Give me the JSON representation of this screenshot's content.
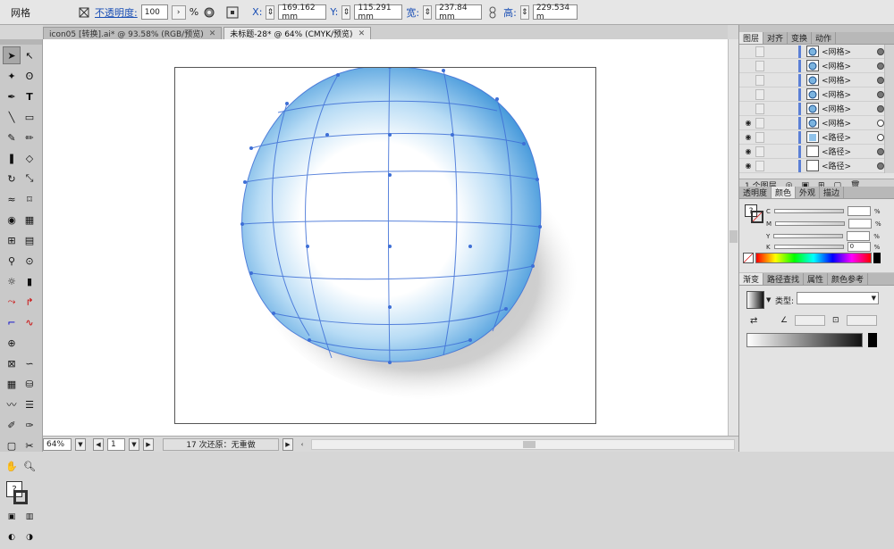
{
  "control_bar": {
    "selection_label": "网格",
    "opacity_label": "不透明度:",
    "opacity_value": "100",
    "percent": "%",
    "x_label": "X:",
    "x_value": "169.162 mm",
    "y_label": "Y:",
    "y_value": "115.291 mm",
    "width_label": "宽:",
    "width_value": "237.84 mm",
    "height_label": "高:",
    "height_value": "229.534 m"
  },
  "tabs": [
    {
      "label": "icon05 [转换].ai* @ 93.58% (RGB/预览)"
    },
    {
      "label": "未标题-28* @ 64% (CMYK/预览)"
    }
  ],
  "status_bar": {
    "zoom": "64%",
    "artboard": "1",
    "status": "17 次还原：无重做"
  },
  "layers_panel": {
    "tabs": [
      "图层",
      "对齐",
      "变换",
      "动作"
    ],
    "rows": [
      {
        "name": "<网格>",
        "visible": false
      },
      {
        "name": "<网格>",
        "visible": false
      },
      {
        "name": "<网格>",
        "visible": false
      },
      {
        "name": "<网格>",
        "visible": false
      },
      {
        "name": "<网格>",
        "visible": false
      },
      {
        "name": "<网格>",
        "visible": true
      },
      {
        "name": "<路径>",
        "visible": true
      },
      {
        "name": "<路径>",
        "visible": true
      },
      {
        "name": "<路径>",
        "visible": true
      }
    ],
    "footer": "1 个图层"
  },
  "color_panel": {
    "tabs": [
      "透明度",
      "颜色",
      "外观",
      "描边"
    ],
    "channels": [
      {
        "label": "C",
        "value": "",
        "unit": "%"
      },
      {
        "label": "M",
        "value": "",
        "unit": "%"
      },
      {
        "label": "Y",
        "value": "",
        "unit": "%"
      },
      {
        "label": "K",
        "value": "0",
        "unit": "%"
      }
    ]
  },
  "gradient_panel": {
    "tabs": [
      "渐变",
      "路径查找",
      "属性",
      "颜色参考"
    ],
    "type_label": "类型:"
  },
  "colors": {
    "accent": "#3b8fdc",
    "mesh_line": "#3e6fd6",
    "ui_bg": "#c4c4c4"
  }
}
